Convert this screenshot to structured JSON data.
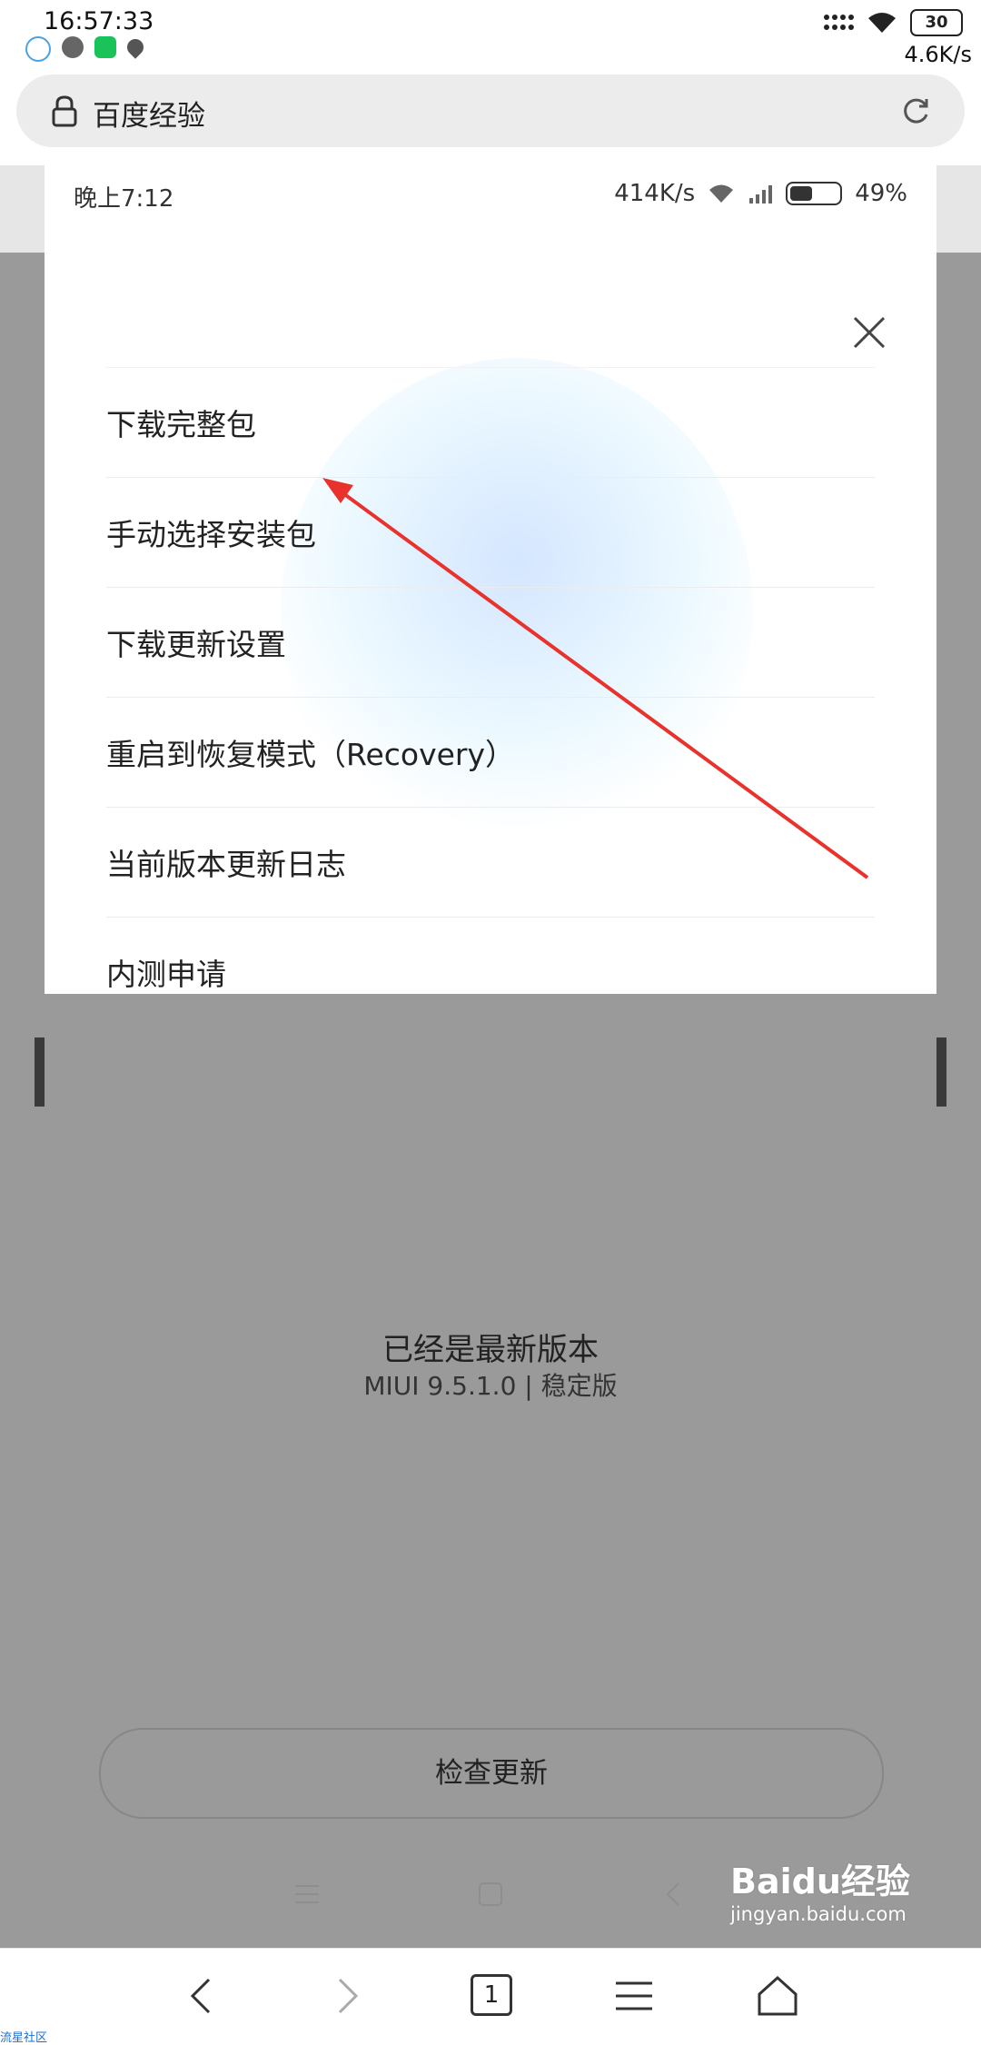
{
  "outer_status": {
    "time": "16:57:33",
    "battery": "30",
    "speed": "4.6K/s",
    "notification_icons": [
      "qq-icon",
      "wechat-icon",
      "app-icon",
      "drop-icon"
    ]
  },
  "browser": {
    "url_title": "百度经验",
    "tab_count": "1",
    "corner_text": "流星社区"
  },
  "screenshot": {
    "status": {
      "time": "晚上7:12",
      "speed": "414K/s",
      "battery": "49%"
    },
    "menu": {
      "items": [
        {
          "label": "下载完整包"
        },
        {
          "label": "手动选择安装包"
        },
        {
          "label": "下载更新设置"
        },
        {
          "label": "重启到恢复模式（Recovery）"
        },
        {
          "label": "当前版本更新日志"
        },
        {
          "label": "内测申请"
        }
      ]
    },
    "latest_title": "已经是最新版本",
    "version_text": "MIUI 9.5.1.0 | 稳定版",
    "check_button": "检查更新"
  },
  "watermark": {
    "logo": "Baidu经验",
    "url": "jingyan.baidu.com"
  },
  "colors": {
    "arrow": "#e8322b",
    "overlay": "#9a9a9a",
    "green_text": "#0a8a0a"
  }
}
